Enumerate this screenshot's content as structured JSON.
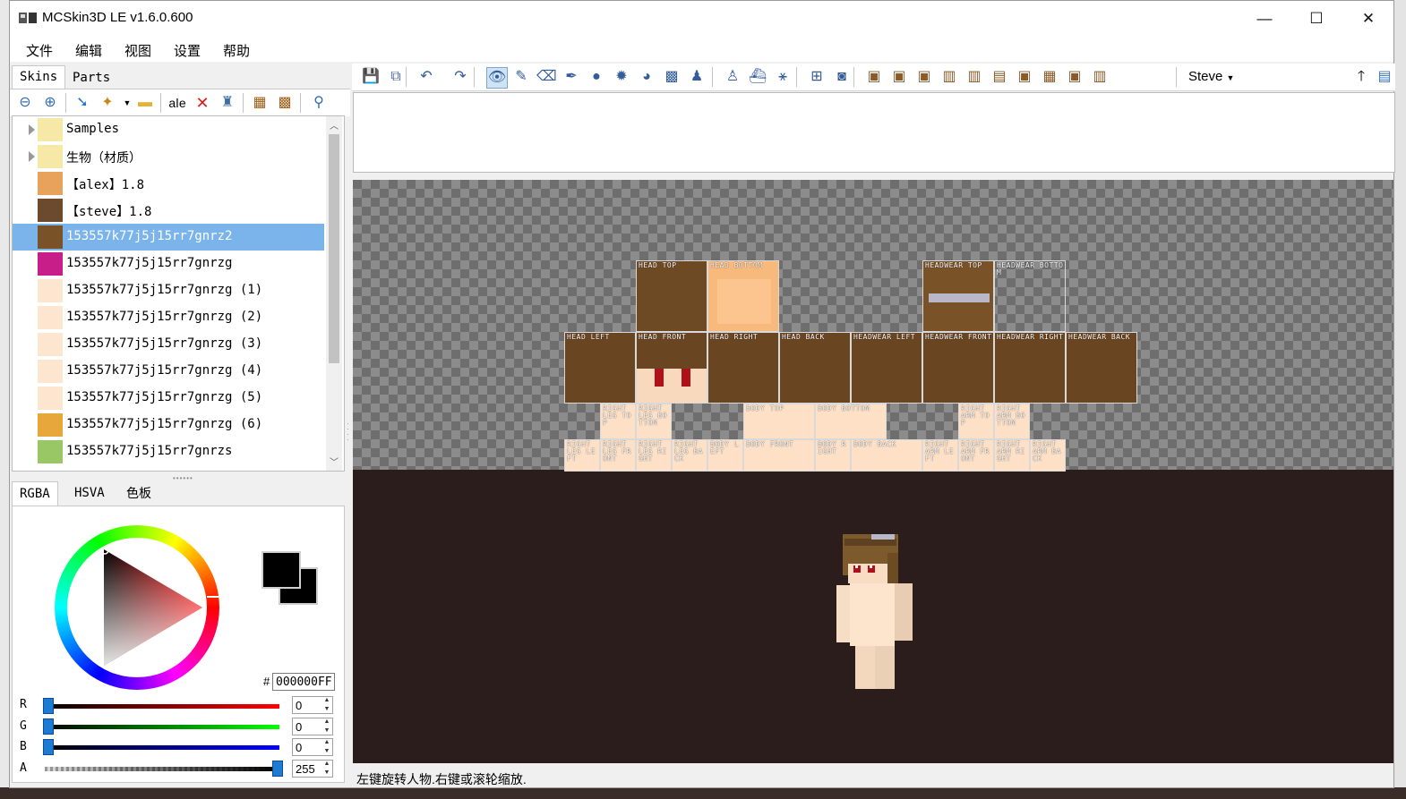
{
  "window": {
    "title": "MCSkin3D LE v1.6.0.600",
    "minimize": "—",
    "maximize": "☐",
    "close": "✕"
  },
  "menu": [
    "文件",
    "编辑",
    "视图",
    "设置",
    "帮助"
  ],
  "left_tabs": {
    "skins": "Skins",
    "parts": "Parts"
  },
  "left_toolbar_icons": [
    "zoom-out-icon",
    "zoom-in-icon",
    "import-icon",
    "new-skin-icon",
    "new-folder-icon",
    "rename-icon",
    "delete-icon",
    "clone-icon",
    "grid-icon",
    "pixel-grid-icon",
    "upload-icon"
  ],
  "skins_tree": [
    {
      "label": "Samples",
      "type": "folder",
      "thumb": "#f6e8a6"
    },
    {
      "label": "生物（材质）",
      "type": "folder",
      "thumb": "#f6e8a6"
    },
    {
      "label": "【alex】1.8",
      "type": "skin",
      "thumb": "#e7a25b"
    },
    {
      "label": "【steve】1.8",
      "type": "skin",
      "thumb": "#6b4a2e"
    },
    {
      "label": "153557k77j5j15rr7gnrz2",
      "type": "skin",
      "thumb": "#7a5228",
      "selected": true
    },
    {
      "label": "153557k77j5j15rr7gnrzg",
      "type": "skin",
      "thumb": "#c81e8a"
    },
    {
      "label": "153557k77j5j15rr7gnrzg (1)",
      "type": "skin",
      "thumb": "#fde6cf"
    },
    {
      "label": "153557k77j5j15rr7gnrzg (2)",
      "type": "skin",
      "thumb": "#fde6cf"
    },
    {
      "label": "153557k77j5j15rr7gnrzg (3)",
      "type": "skin",
      "thumb": "#fde6cf"
    },
    {
      "label": "153557k77j5j15rr7gnrzg (4)",
      "type": "skin",
      "thumb": "#fde6cf"
    },
    {
      "label": "153557k77j5j15rr7gnrzg (5)",
      "type": "skin",
      "thumb": "#fde6cf"
    },
    {
      "label": "153557k77j5j15rr7gnrzg (6)",
      "type": "skin",
      "thumb": "#e7a73a"
    },
    {
      "label": "153557k77j5j15rr7gnrzs",
      "type": "skin",
      "thumb": "#9ac765"
    }
  ],
  "color_tabs": {
    "rgba": "RGBA",
    "hsva": "HSVA",
    "palette": "色板"
  },
  "color": {
    "hash": "#",
    "hex": "000000FF",
    "primary": "#000000",
    "secondary": "#000000",
    "r_label": "R",
    "r": "0",
    "g_label": "G",
    "g": "0",
    "b_label": "B",
    "b": "0",
    "a_label": "A",
    "a": "255"
  },
  "main_toolbar": {
    "model": "Steve",
    "icons": [
      "save-icon",
      "save-all-icon",
      "undo-icon",
      "redo-icon",
      "camera-icon",
      "pencil-icon",
      "eraser-icon",
      "dropper-icon",
      "dodge-burn-icon",
      "darken-lighten-icon",
      "noise-icon",
      "flood-fill-icon",
      "stamp-icon",
      "perspective-icon",
      "textured-icon",
      "grass-icon",
      "pixel-icon",
      "clone-icon",
      "toggle-head-icon",
      "toggle-helmet-icon",
      "toggle-chest-icon",
      "toggle-left-arm-icon",
      "toggle-right-arm-icon",
      "toggle-left-leg-icon",
      "toggle-right-leg-icon",
      "toggle-overlay-icon",
      "alpha-icon",
      "mode-icon",
      "arrow-up-icon",
      "panel-icon"
    ]
  },
  "skin_parts": [
    {
      "label": "HEAD TOP",
      "color": "#6e4a24"
    },
    {
      "label": "HEAD BOTTOM",
      "color": "#f7b97c"
    },
    {
      "label": "HEADWEAR TOP",
      "color": "#7a5228"
    },
    {
      "label": "HEADWEAR BOTTOM",
      "color": ""
    },
    {
      "label": "HEAD LEFT",
      "color": "#6a4522"
    },
    {
      "label": "HEAD FRONT",
      "color": "#6a4522"
    },
    {
      "label": "HEAD RIGHT",
      "color": "#6a4522"
    },
    {
      "label": "HEAD BACK",
      "color": "#6a4522"
    },
    {
      "label": "HEADWEAR LEFT",
      "color": "#6a4522"
    },
    {
      "label": "HEADWEAR FRONT",
      "color": "#6a4522"
    },
    {
      "label": "HEADWEAR RIGHT",
      "color": "#6a4522"
    },
    {
      "label": "HEADWEAR BACK",
      "color": "#6a4522"
    },
    {
      "label": "RIGHT LEG TOP",
      "color": "#fde0c6"
    },
    {
      "label": "RIGHT LEG BOTTOM",
      "color": "#fde0c6"
    },
    {
      "label": "BODY TOP",
      "color": "#fde0c6"
    },
    {
      "label": "BODY BOTTOM",
      "color": "#fde0c6"
    },
    {
      "label": "RIGHT ARM TOP",
      "color": "#fde0c6"
    },
    {
      "label": "RIGHT ARM BOTTOM",
      "color": "#fde0c6"
    },
    {
      "label": "RIGHT LEG LEFT",
      "color": "#fde0c6"
    },
    {
      "label": "RIGHT LEG FRONT",
      "color": "#fde0c6"
    },
    {
      "label": "RIGHT LEG RIGHT",
      "color": "#fde0c6"
    },
    {
      "label": "RIGHT LEG BACK",
      "color": "#fde0c6"
    },
    {
      "label": "BODY LEFT",
      "color": "#fde0c6"
    },
    {
      "label": "BODY FRONT",
      "color": "#fde0c6"
    },
    {
      "label": "BODY RIGHT",
      "color": "#fde0c6"
    },
    {
      "label": "BODY BACK",
      "color": "#fde0c6"
    },
    {
      "label": "RIGHT ARM LEFT",
      "color": "#fde0c6"
    },
    {
      "label": "RIGHT ARM FRONT",
      "color": "#fde0c6"
    },
    {
      "label": "RIGHT ARM RIGHT",
      "color": "#fde0c6"
    },
    {
      "label": "RIGHT ARM BACK",
      "color": "#fde0c6"
    }
  ],
  "status": "左键旋转人物.右键或滚轮缩放."
}
